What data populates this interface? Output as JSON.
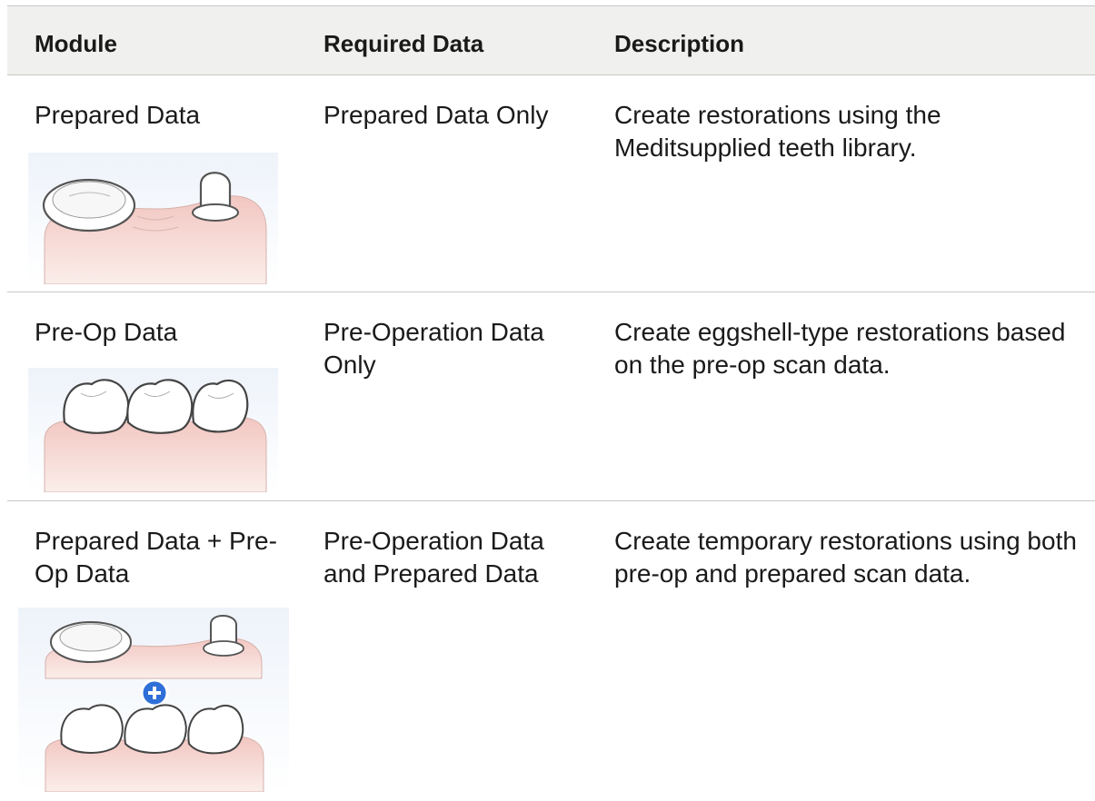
{
  "table": {
    "headers": [
      "Module",
      "Required Data",
      "Description"
    ],
    "rows": [
      {
        "module": "Prepared Data",
        "required": "Prepared Data Only",
        "description": "Create restorations using the Meditsupplied teeth library.",
        "image": "prepared-teeth-illustration"
      },
      {
        "module": "Pre-Op Data",
        "required": "Pre-Operation Data Only",
        "description": "Create eggshell-type restorations based on the pre-op scan data.",
        "image": "preop-teeth-illustration"
      },
      {
        "module": "Prepared Data + Pre-Op Data",
        "required": "Pre-Operation Data and Prepared Data",
        "description": "Create temporary restorations using both pre-op and prepared scan data.",
        "image": "combined-teeth-illustration"
      }
    ]
  },
  "colors": {
    "header_bg": "#f0f1ee",
    "divider": "#c8c8c8",
    "gum": "#f3c9c4",
    "plus_badge": "#2f6fd8"
  }
}
